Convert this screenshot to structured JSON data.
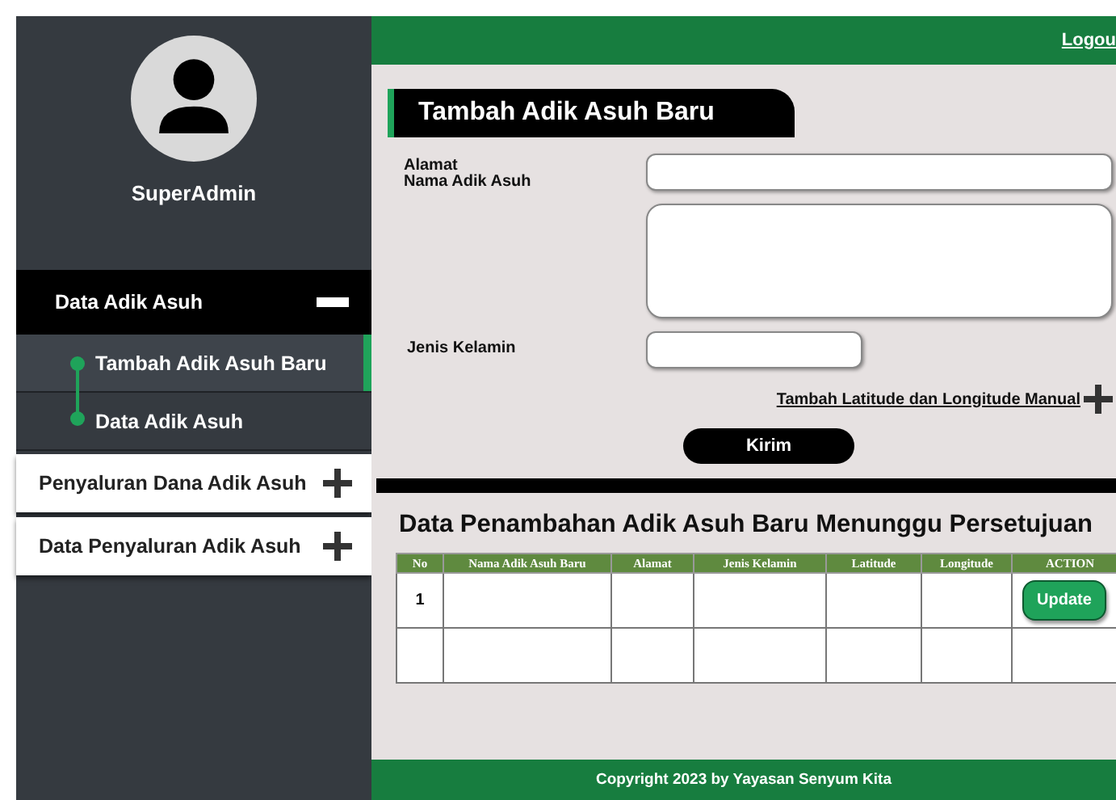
{
  "sidebar": {
    "user": "SuperAdmin",
    "menu": [
      {
        "label": "Data Adik Asuh",
        "expanded": true,
        "children": [
          {
            "label": "Tambah Adik Asuh Baru",
            "selected": true
          },
          {
            "label": "Data Adik Asuh",
            "selected": false
          }
        ]
      },
      {
        "label": "Penyaluran Dana Adik Asuh",
        "expanded": false
      },
      {
        "label": "Data Penyaluran Adik Asuh",
        "expanded": false
      }
    ]
  },
  "header": {
    "logout": "Logou"
  },
  "form": {
    "title": "Tambah Adik Asuh Baru",
    "fields": [
      {
        "kind": "text",
        "labels": [
          "Alamat",
          "Nama Adik Asuh"
        ]
      },
      {
        "kind": "textarea"
      },
      {
        "kind": "short",
        "labels": [
          "Jenis Kelamin"
        ]
      }
    ],
    "link": "Tambah Latitude dan Longitude Manual",
    "submit": "Kirim"
  },
  "table": {
    "title": "Data Penambahan Adik Asuh Baru Menunggu Persetujuan",
    "columns": [
      "No",
      "Nama Adik Asuh Baru",
      "Alamat",
      "Jenis Kelamin",
      "Latitude",
      "Longitude",
      "ACTION"
    ],
    "rows": [
      {
        "no": "1",
        "action": "Update"
      },
      {}
    ]
  },
  "footer": "Copyright 2023 by Yayasan Senyum Kita"
}
